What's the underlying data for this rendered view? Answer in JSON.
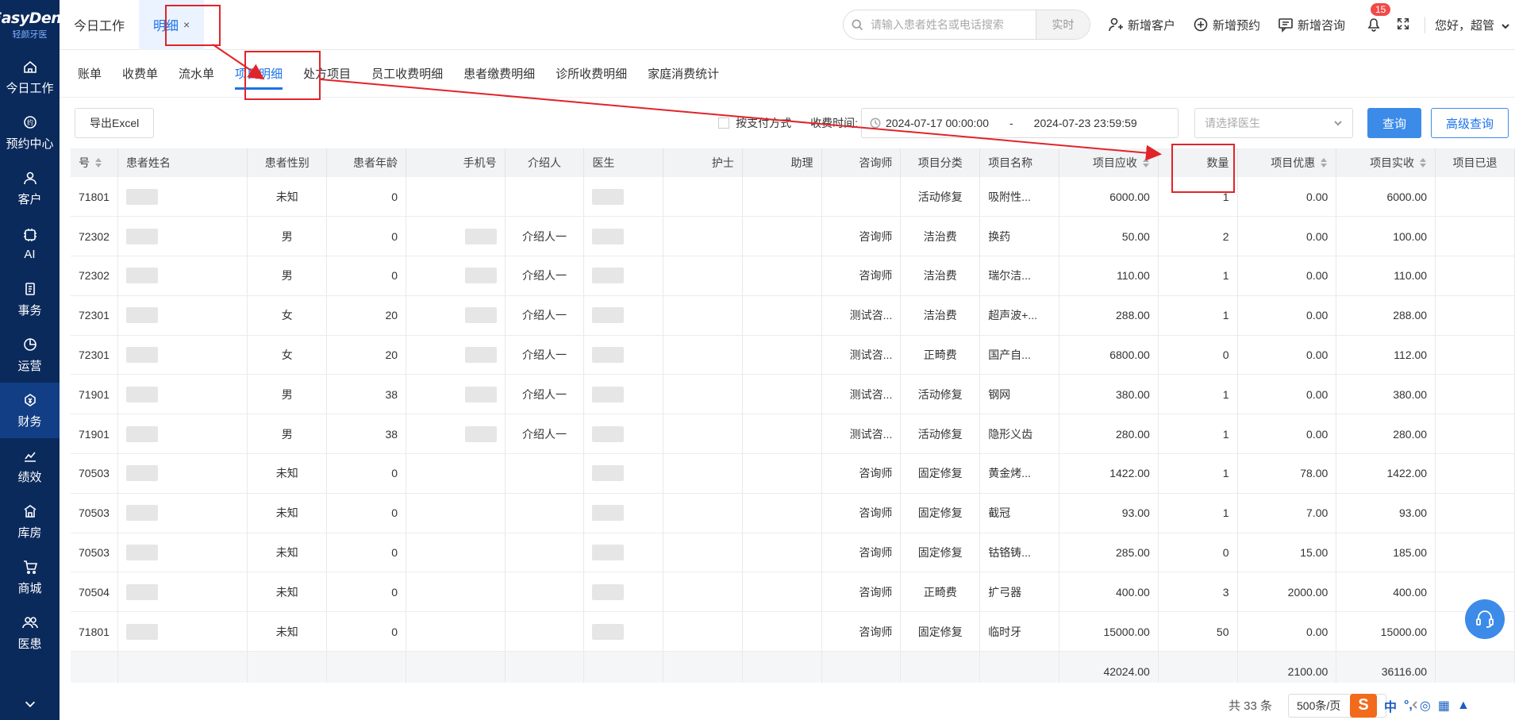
{
  "logo": {
    "main": "EasyDent",
    "sub": "轻颜牙医"
  },
  "nav": [
    {
      "id": "today",
      "label": "今日工作",
      "icon": "home-icon"
    },
    {
      "id": "booking",
      "label": "预约中心",
      "icon": "booking-icon"
    },
    {
      "id": "customer",
      "label": "客户",
      "icon": "user-icon"
    },
    {
      "id": "ai",
      "label": "AI",
      "icon": "ai-icon"
    },
    {
      "id": "affairs",
      "label": "事务",
      "icon": "clipboard-icon"
    },
    {
      "id": "operation",
      "label": "运营",
      "icon": "pie-icon"
    },
    {
      "id": "finance",
      "label": "财务",
      "icon": "money-icon"
    },
    {
      "id": "performance",
      "label": "绩效",
      "icon": "chart-icon"
    },
    {
      "id": "storage",
      "label": "库房",
      "icon": "warehouse-icon"
    },
    {
      "id": "mall",
      "label": "商城",
      "icon": "cart-icon"
    },
    {
      "id": "patient",
      "label": "医患",
      "icon": "people-icon"
    }
  ],
  "topbar": {
    "tabs": [
      {
        "label": "今日工作"
      },
      {
        "label": "明细"
      }
    ],
    "close_glyph": "×",
    "search_placeholder": "请输入患者姓名或电话搜索",
    "realtime": "实时",
    "actions": {
      "new_customer": "新增客户",
      "new_booking": "新增预约",
      "new_consult": "新增咨询"
    },
    "badge": "15",
    "greeting": "您好，超管"
  },
  "subtabs": [
    "账单",
    "收费单",
    "流水单",
    "项目明细",
    "处方项目",
    "员工收费明细",
    "患者缴费明细",
    "诊所收费明细",
    "家庭消费统计"
  ],
  "toolbar": {
    "export": "导出Excel",
    "pay_method": "按支付方式",
    "charge_time_label": "收费时间:",
    "date_start": "2024-07-17 00:00:00",
    "date_sep": "-",
    "date_end": "2024-07-23 23:59:59",
    "doctor_placeholder": "请选择医生",
    "query": "查询",
    "advanced": "高级查询"
  },
  "table": {
    "headers": [
      "号",
      "患者姓名",
      "患者性别",
      "患者年龄",
      "手机号",
      "介绍人",
      "医生",
      "护士",
      "助理",
      "咨询师",
      "项目分类",
      "项目名称",
      "项目应收",
      "数量",
      "项目优惠",
      "项目实收",
      "项目已退"
    ],
    "rows": [
      [
        "71801",
        "",
        "未知",
        "0",
        "",
        "",
        "",
        "",
        "",
        "",
        "活动修复",
        "吸附性...",
        "6000.00",
        "1",
        "0.00",
        "6000.00",
        ""
      ],
      [
        "72302",
        "",
        "男",
        "0",
        "",
        "介绍人一",
        "",
        "",
        "",
        "咨询师",
        "洁治费",
        "换药",
        "50.00",
        "2",
        "0.00",
        "100.00",
        ""
      ],
      [
        "72302",
        "",
        "男",
        "0",
        "",
        "介绍人一",
        "",
        "",
        "",
        "咨询师",
        "洁治费",
        "瑞尔洁...",
        "110.00",
        "1",
        "0.00",
        "110.00",
        ""
      ],
      [
        "72301",
        "",
        "女",
        "20",
        "",
        "介绍人一",
        "",
        "",
        "",
        "测试咨...",
        "洁治费",
        "超声波+...",
        "288.00",
        "1",
        "0.00",
        "288.00",
        ""
      ],
      [
        "72301",
        "",
        "女",
        "20",
        "",
        "介绍人一",
        "",
        "",
        "",
        "测试咨...",
        "正畸费",
        "国产自...",
        "6800.00",
        "0",
        "0.00",
        "112.00",
        ""
      ],
      [
        "71901",
        "",
        "男",
        "38",
        "",
        "介绍人一",
        "",
        "",
        "",
        "测试咨...",
        "活动修复",
        "钢网",
        "380.00",
        "1",
        "0.00",
        "380.00",
        ""
      ],
      [
        "71901",
        "",
        "男",
        "38",
        "",
        "介绍人一",
        "",
        "",
        "",
        "测试咨...",
        "活动修复",
        "隐形义齿",
        "280.00",
        "1",
        "0.00",
        "280.00",
        ""
      ],
      [
        "70503",
        "",
        "未知",
        "0",
        "",
        "",
        "",
        "",
        "",
        "咨询师",
        "固定修复",
        "黄金烤...",
        "1422.00",
        "1",
        "78.00",
        "1422.00",
        ""
      ],
      [
        "70503",
        "",
        "未知",
        "0",
        "",
        "",
        "",
        "",
        "",
        "咨询师",
        "固定修复",
        "截冠",
        "93.00",
        "1",
        "7.00",
        "93.00",
        ""
      ],
      [
        "70503",
        "",
        "未知",
        "0",
        "",
        "",
        "",
        "",
        "",
        "咨询师",
        "固定修复",
        "钴铬铸...",
        "285.00",
        "0",
        "15.00",
        "185.00",
        ""
      ],
      [
        "70504",
        "",
        "未知",
        "0",
        "",
        "",
        "",
        "",
        "",
        "咨询师",
        "正畸费",
        "扩弓器",
        "400.00",
        "3",
        "2000.00",
        "400.00",
        ""
      ],
      [
        "71801",
        "",
        "未知",
        "0",
        "",
        "",
        "",
        "",
        "",
        "咨询师",
        "固定修复",
        "临时牙",
        "15000.00",
        "50",
        "0.00",
        "15000.00",
        ""
      ]
    ],
    "totals": {
      "receivable": "42024.00",
      "discount": "2100.00",
      "received": "36116.00"
    }
  },
  "pager": {
    "total": "共 33 条",
    "page_size": "500条/页"
  },
  "ime": {
    "logo": "S",
    "lang": "中",
    "punct": "°,"
  }
}
